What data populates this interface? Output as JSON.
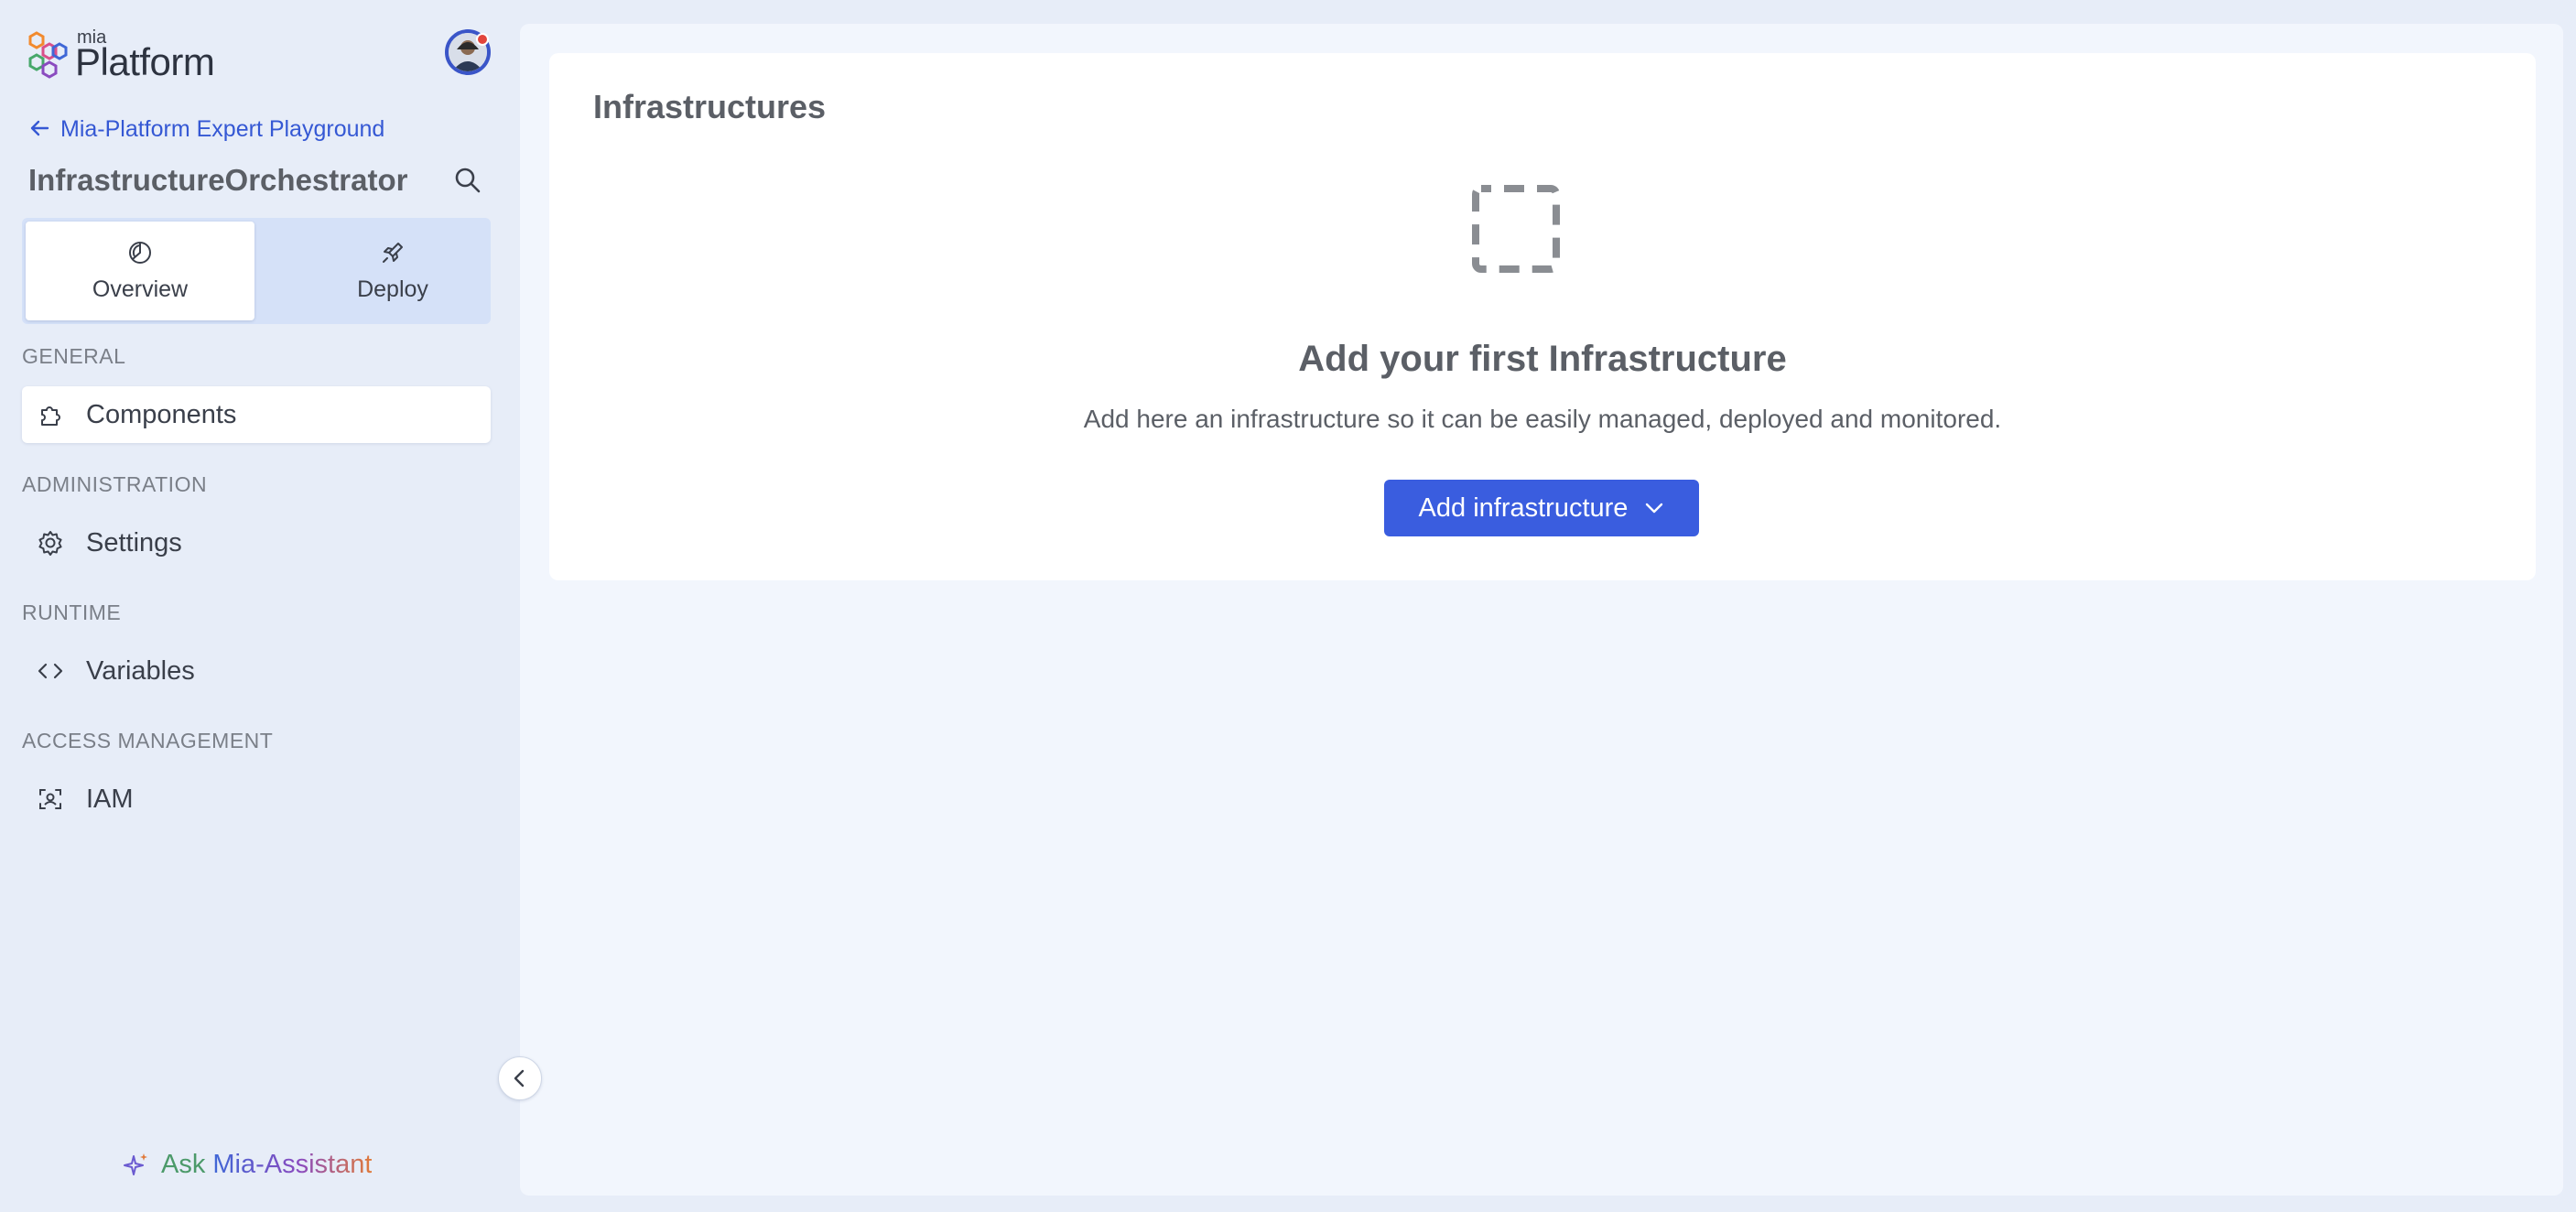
{
  "brand": {
    "small": "mia",
    "name": "Platform"
  },
  "user": {
    "avatar_icon": "user-avatar-icon",
    "notification_color": "#e2453c"
  },
  "breadcrumb": {
    "back_label": "Mia-Platform Expert Playground"
  },
  "project": {
    "title": "InfrastructureOrchestrator"
  },
  "segments": [
    {
      "label": "Overview",
      "icon": "pie-chart-icon",
      "active": true
    },
    {
      "label": "Deploy",
      "icon": "rocket-icon",
      "active": false
    }
  ],
  "sidebar": {
    "sections": [
      {
        "label": "GENERAL",
        "items": [
          {
            "label": "Components",
            "icon": "puzzle-icon",
            "active": true
          }
        ]
      },
      {
        "label": "ADMINISTRATION",
        "items": [
          {
            "label": "Settings",
            "icon": "gear-icon",
            "active": false
          }
        ]
      },
      {
        "label": "RUNTIME",
        "items": [
          {
            "label": "Variables",
            "icon": "code-brackets-icon",
            "active": false
          }
        ]
      },
      {
        "label": "ACCESS MANAGEMENT",
        "items": [
          {
            "label": "IAM",
            "icon": "user-scan-icon",
            "active": false
          }
        ]
      }
    ],
    "assistant": {
      "ask": "Ask",
      "name": "Mia-Assistant"
    }
  },
  "main": {
    "title": "Infrastructures",
    "empty_state": {
      "title": "Add your first Infrastructure",
      "description": "Add here an infrastructure so it can be easily managed, deployed and monitored.",
      "button_label": "Add infrastructure"
    }
  },
  "colors": {
    "accent": "#3a5ddf",
    "link": "#3558d4",
    "sidebar_bg": "#e7edf8",
    "main_bg": "#f2f6fd"
  }
}
